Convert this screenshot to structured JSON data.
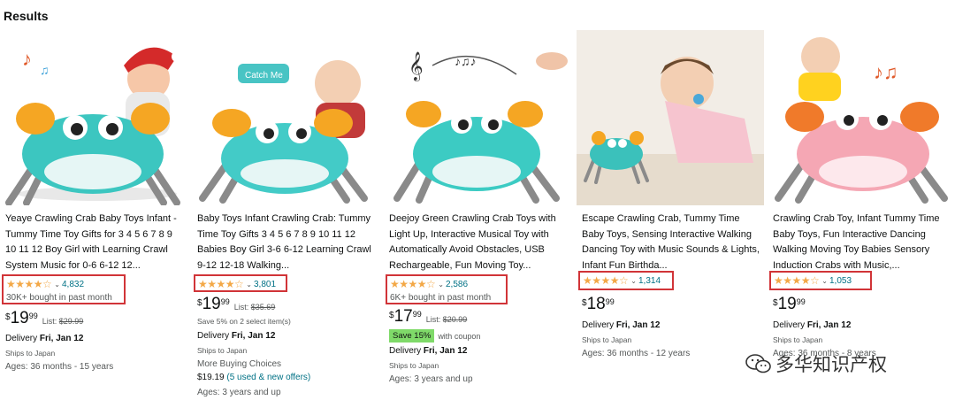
{
  "header": {
    "title": "Results"
  },
  "watermark": {
    "text": "多华知识产权"
  },
  "products": [
    {
      "title": "Yeaye Crawling Crab Baby Toys Infant - Tummy Time Toy Gifts for 3 4 5 6 7 8 9 10 11 12 Boy Girl with Learning Crawl System Music for 0-6 6-12 12...",
      "stars": "★★★★☆",
      "rating_count": "4,832",
      "bought": "30K+ bought in past month",
      "price_symbol": "$",
      "price_whole": "19",
      "price_fraction": "99",
      "list_label": "List:",
      "list_price": "$29.99",
      "delivery_label": "Delivery",
      "delivery_date": "Fri, Jan 12",
      "ships": "Ships to Japan",
      "ages": "Ages: 36 months - 15 years",
      "crab_color": "#3cc6c0"
    },
    {
      "title": "Baby Toys Infant Crawling Crab: Tummy Time Toy Gifts 3 4 5 6 7 8 9 10 11 12 Babies Boy Girl 3-6 6-12 Learning Crawl 9-12 12-18 Walking...",
      "stars": "★★★★☆",
      "rating_count": "3,801",
      "price_symbol": "$",
      "price_whole": "19",
      "price_fraction": "99",
      "list_label": "List:",
      "list_price": "$35.69",
      "save_text": "Save 5% on 2 select item(s)",
      "delivery_label": "Delivery",
      "delivery_date": "Fri, Jan 12",
      "ships": "Ships to Japan",
      "more_choices": "More Buying Choices",
      "offer_price": "$19.19",
      "offer_link": "(5 used & new offers)",
      "ages": "Ages: 3 years and up",
      "bubble_text": "Catch Me",
      "crab_color": "#43cbc7"
    },
    {
      "title": "Deejoy Green Crawling Crab Toys with Light Up, Interactive Musical Toy with Automatically Avoid Obstacles, USB Rechargeable, Fun Moving Toy...",
      "stars": "★★★★☆",
      "rating_count": "2,586",
      "bought": "6K+ bought in past month",
      "price_symbol": "$",
      "price_whole": "17",
      "price_fraction": "99",
      "list_label": "List:",
      "list_price": "$20.99",
      "save_badge": "Save 15%",
      "coupon_text": "with coupon",
      "delivery_label": "Delivery",
      "delivery_date": "Fri, Jan 12",
      "ships": "Ships to Japan",
      "ages": "Ages: 3 years and up",
      "crab_color": "#3ccbc3"
    },
    {
      "title": "Escape Crawling Crab, Tummy Time Baby Toys, Sensing Interactive Walking Dancing Toy with Music Sounds & Lights, Infant Fun Birthda...",
      "stars": "★★★★☆",
      "rating_count": "1,314",
      "price_symbol": "$",
      "price_whole": "18",
      "price_fraction": "99",
      "delivery_label": "Delivery",
      "delivery_date": "Fri, Jan 12",
      "ships": "Ships to Japan",
      "ages": "Ages: 36 months - 12 years",
      "crab_color": "#3bc1bb"
    },
    {
      "title": "Crawling Crab Toy, Infant Tummy Time Baby Toys, Fun Interactive Dancing Walking Moving Toy Babies Sensory Induction Crabs with Music,...",
      "stars": "★★★★☆",
      "rating_count": "1,053",
      "price_symbol": "$",
      "price_whole": "19",
      "price_fraction": "99",
      "delivery_label": "Delivery",
      "delivery_date": "Fri, Jan 12",
      "ships": "Ships to Japan",
      "ages": "Ages: 36 months - 8 years",
      "crab_color": "#f5a7b4"
    }
  ],
  "colors": {
    "highlight": "#d13438",
    "link": "#007185",
    "star": "#f3a847",
    "coupon": "#7fda69"
  }
}
